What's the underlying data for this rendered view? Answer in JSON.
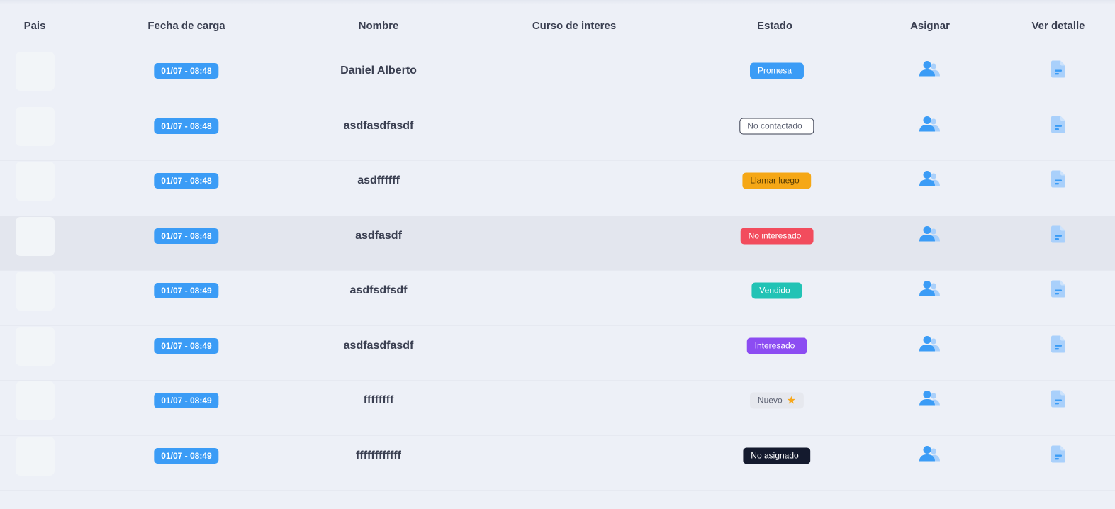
{
  "columns": [
    "Pais",
    "Fecha de carga",
    "Nombre",
    "Curso de interes",
    "Estado",
    "Asignar",
    "Ver detalle"
  ],
  "rows": [
    {
      "date": "01/07 - 08:48",
      "name": "Daniel Alberto",
      "status": "Promesa",
      "status_style": {
        "bg": "#3b9cf6",
        "fg": "#ffffff",
        "border": "none"
      },
      "star": ""
    },
    {
      "date": "01/07 - 08:48",
      "name": "asdfasdfasdf",
      "status": "No contactado",
      "status_style": {
        "bg": "#ffffff",
        "fg": "#5a5f70",
        "border": "#3a3f51"
      },
      "star": ""
    },
    {
      "date": "01/07 - 08:48",
      "name": "asdffffff",
      "status": "Llamar luego",
      "status_style": {
        "bg": "#f5a716",
        "fg": "#5a3d00",
        "border": "none"
      },
      "star": ""
    },
    {
      "date": "01/07 - 08:48",
      "name": "asdfasdf",
      "status": "No interesado",
      "status_style": {
        "bg": "#f24c5d",
        "fg": "#ffffff",
        "border": "none"
      },
      "star": ""
    },
    {
      "date": "01/07 - 08:49",
      "name": "asdfsdfsdf",
      "status": "Vendido",
      "status_style": {
        "bg": "#22c3b5",
        "fg": "#ffffff",
        "border": "none"
      },
      "star": ""
    },
    {
      "date": "01/07 - 08:49",
      "name": "asdfasdfasdf",
      "status": "Interesado",
      "status_style": {
        "bg": "#8c4cf2",
        "fg": "#ffffff",
        "border": "none"
      },
      "star": ""
    },
    {
      "date": "01/07 - 08:49",
      "name": "ffffffff",
      "status": "Nuevo",
      "status_style": {
        "bg": "#e6e8ee",
        "fg": "#5a5f70",
        "border": "none"
      },
      "star": "★"
    },
    {
      "date": "01/07 - 08:49",
      "name": "ffffffffffff",
      "status": "No asignado",
      "status_style": {
        "bg": "#141a2e",
        "fg": "#ffffff",
        "border": "none"
      },
      "star": ""
    }
  ],
  "icons": {
    "assign": "users-icon",
    "detail": "document-icon"
  },
  "colors": {
    "accent": "#3b9cf6",
    "icon_light": "#a9d0fb",
    "row_highlight": "#e3e6ee"
  }
}
